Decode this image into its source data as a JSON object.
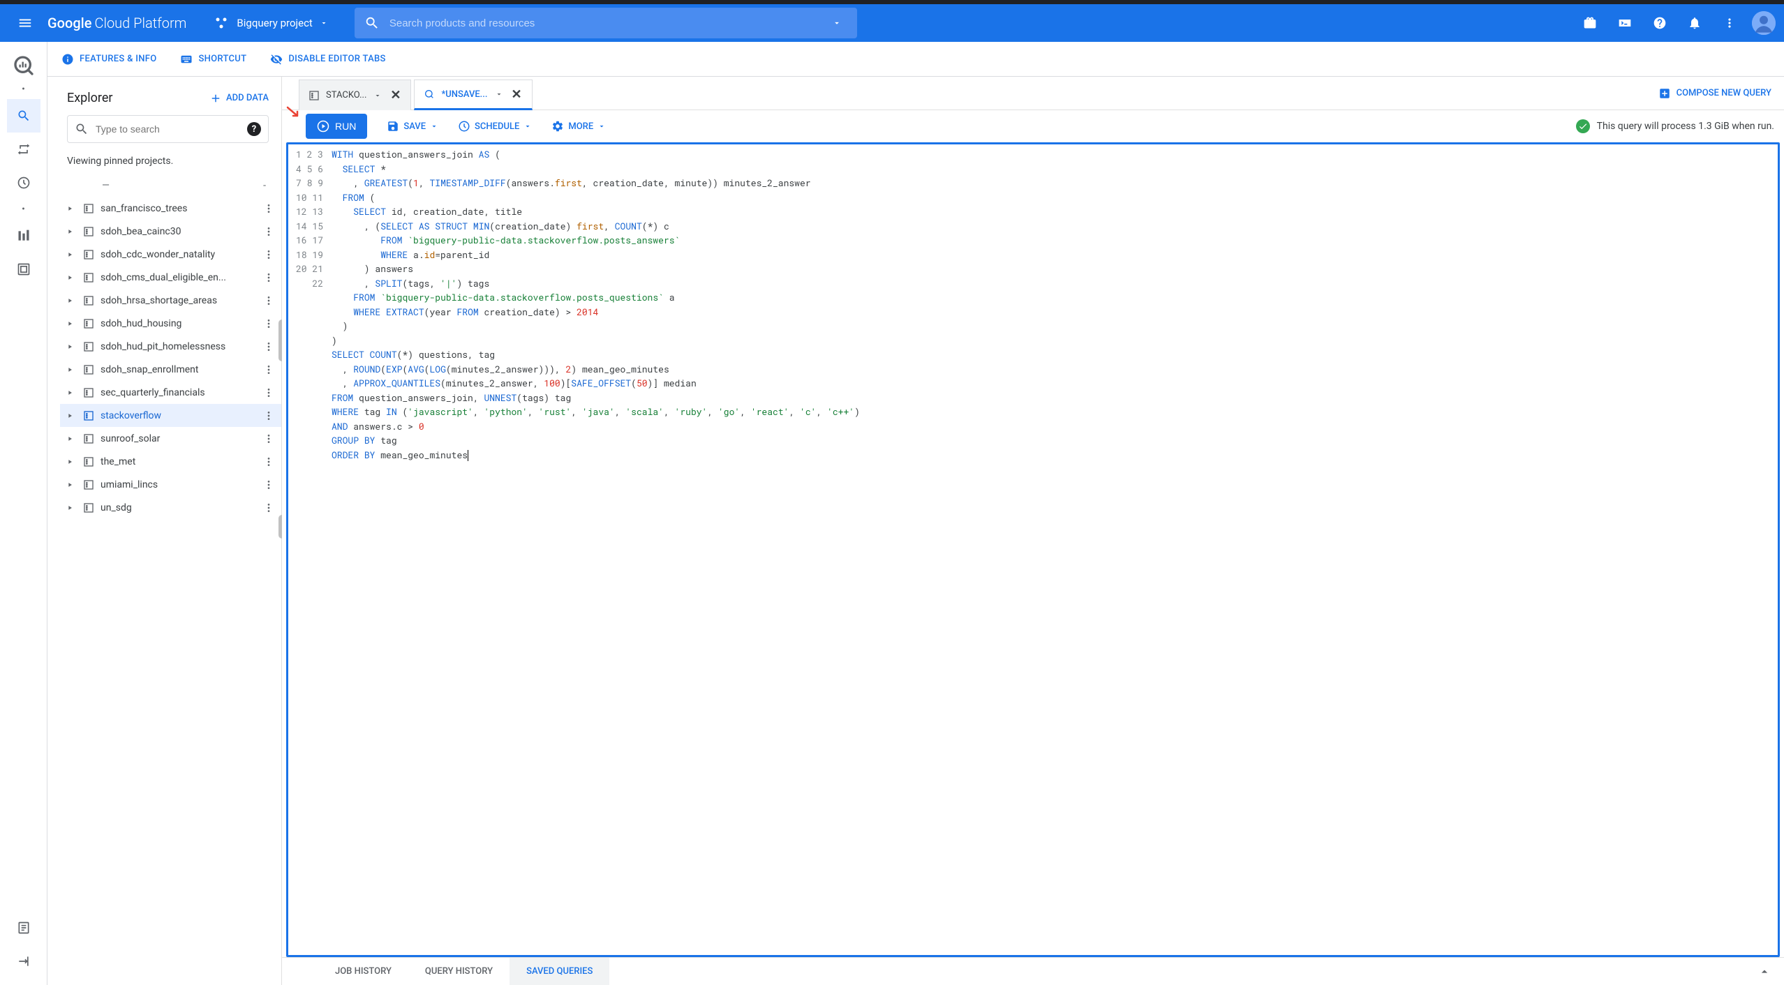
{
  "header": {
    "logo_bold": "Google",
    "logo_light": "Cloud Platform",
    "project_name": "Bigquery project",
    "search_placeholder": "Search products and resources"
  },
  "feature_bar": {
    "features_info": "FEATURES & INFO",
    "shortcut": "SHORTCUT",
    "disable_tabs": "DISABLE EDITOR TABS"
  },
  "explorer": {
    "title": "Explorer",
    "add_data": "ADD DATA",
    "search_placeholder": "Type to search",
    "viewing": "Viewing pinned projects.",
    "datasets": [
      "san_francisco_trees",
      "sdoh_bea_cainc30",
      "sdoh_cdc_wonder_natality",
      "sdoh_cms_dual_eligible_en...",
      "sdoh_hrsa_shortage_areas",
      "sdoh_hud_housing",
      "sdoh_hud_pit_homelessness",
      "sdoh_snap_enrollment",
      "sec_quarterly_financials",
      "stackoverflow",
      "sunroof_solar",
      "the_met",
      "umiami_lincs",
      "un_sdg"
    ],
    "selected_index": 9
  },
  "tabs": {
    "tab1_title": "STACKO...",
    "tab2_title": "*UNSAVE...",
    "compose": "COMPOSE NEW QUERY"
  },
  "toolbar": {
    "run": "RUN",
    "save": "SAVE",
    "schedule": "SCHEDULE",
    "more": "MORE",
    "validate_msg": "This query will process 1.3 GiB when run."
  },
  "bottom_tabs": {
    "job": "JOB HISTORY",
    "query": "QUERY HISTORY",
    "saved": "SAVED QUERIES"
  },
  "sql": {
    "lines": 22
  }
}
